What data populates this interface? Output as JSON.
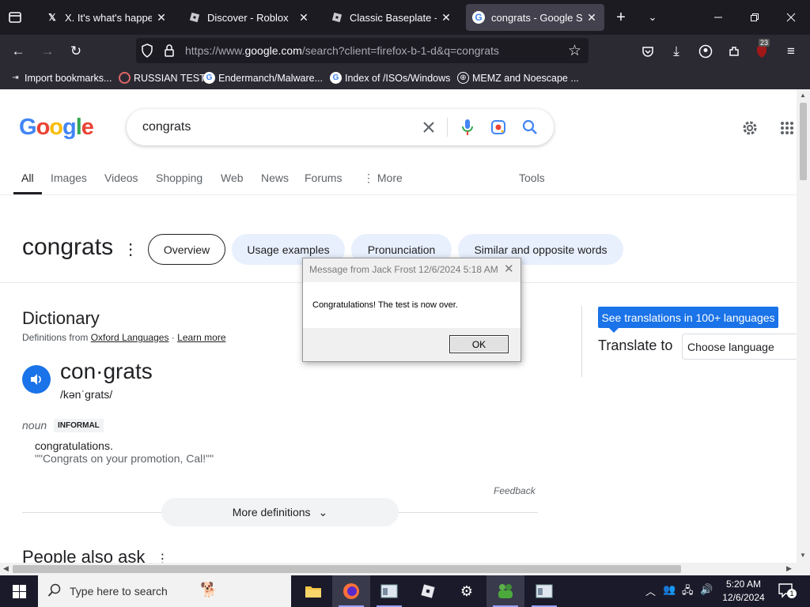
{
  "browser": {
    "tabs": [
      {
        "title": "X. It's what's happening",
        "icon": "x-logo-icon"
      },
      {
        "title": "Discover - Roblox",
        "icon": "roblox-icon"
      },
      {
        "title": "Classic Baseplate - Roblox",
        "icon": "roblox-icon"
      },
      {
        "title": "congrats - Google Search",
        "icon": "google-icon"
      }
    ],
    "url_prefix": "https://www.",
    "url_domain": "google.com",
    "url_rest": "/search?client=firefox-b-1-d&q=congrats",
    "notification_count": "23",
    "bookmarks": [
      "Import bookmarks...",
      "RUSSIAN TEST",
      "Endermanch/Malware...",
      "Index of /ISOs/Windows",
      "MEMZ and Noescape ..."
    ]
  },
  "google": {
    "logo": "Google",
    "query": "congrats",
    "nav_tabs": [
      "All",
      "Images",
      "Videos",
      "Shopping",
      "Web",
      "News",
      "Forums",
      "More"
    ],
    "tools": "Tools",
    "term": "congrats",
    "chips": [
      "Overview",
      "Usage examples",
      "Pronunciation",
      "Similar and opposite words"
    ],
    "dictionary": {
      "title": "Dictionary",
      "source_prefix": "Definitions from",
      "source": "Oxford Languages",
      "learn_more": "Learn more",
      "word": "con·grats",
      "pronunciation": "/kənˈgrats/",
      "part_of_speech": "noun",
      "register": "INFORMAL",
      "definition": "congratulations.",
      "example": "\"\"Congrats on your promotion, Cal!\"\"",
      "feedback": "Feedback",
      "more_definitions": "More definitions"
    },
    "people_also_ask": "People also ask",
    "translate": {
      "button": "See translations in 100+ languages",
      "label": "Translate to",
      "select": "Choose language"
    }
  },
  "dialog": {
    "title": "Message from Jack Frost 12/6/2024 5:18 AM",
    "message": "Congratulations! The test is now over.",
    "ok": "OK"
  },
  "taskbar": {
    "search_placeholder": "Type here to search",
    "time": "5:20 AM",
    "date": "12/6/2024",
    "notification_count": "1"
  },
  "colors": {
    "google_blue": "#1a73e8",
    "chip_bg": "#e8f0fe",
    "firefox_dark": "#1c1b22"
  }
}
